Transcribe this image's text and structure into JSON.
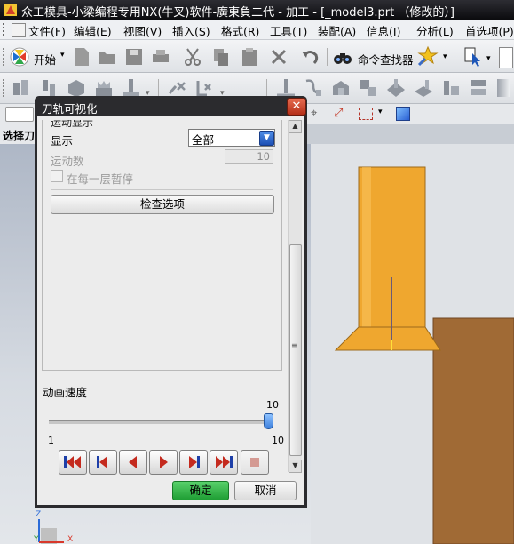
{
  "window": {
    "title": "众工模具-小梁编程专用NX(牛叉)软件-廣東負二代 - 加工 - [_model3.prt （修改的）]"
  },
  "menubar": {
    "items": [
      {
        "label": "文件(F)"
      },
      {
        "label": "编辑(E)"
      },
      {
        "label": "视图(V)"
      },
      {
        "label": "插入(S)"
      },
      {
        "label": "格式(R)"
      },
      {
        "label": "工具(T)"
      },
      {
        "label": "装配(A)"
      },
      {
        "label": "信息(I)"
      },
      {
        "label": "分析(L)"
      },
      {
        "label": "首选项(P)"
      }
    ]
  },
  "toolbar1": {
    "start_label": "开始",
    "command_finder_label": "命令查找器"
  },
  "selection_bar": {
    "label": "选择刀"
  },
  "dialog": {
    "title": "刀轨可视化",
    "close_glyph": "✕",
    "section_partial": "运动显示",
    "display_label": "显示",
    "display_value": "全部",
    "motion_count_label": "运动数",
    "motion_count_value": "10",
    "pause_each_layer_label": "在每一层暂停",
    "check_options_label": "检查选项",
    "animation_speed_label": "动画速度",
    "speed_value": "10",
    "speed_min": "1",
    "speed_max": "10",
    "speed_fraction": 1.0,
    "ok_label": "确定",
    "cancel_label": "取消"
  },
  "colors": {
    "accent_blue": "#1f4fa8",
    "tool_orange": "#efa72f",
    "stock_brown": "#a06a35",
    "ok_green": "#2fb446",
    "close_red": "#c8442a"
  },
  "axes_triad": {
    "z": "Z",
    "x": "X",
    "y": "Y"
  }
}
